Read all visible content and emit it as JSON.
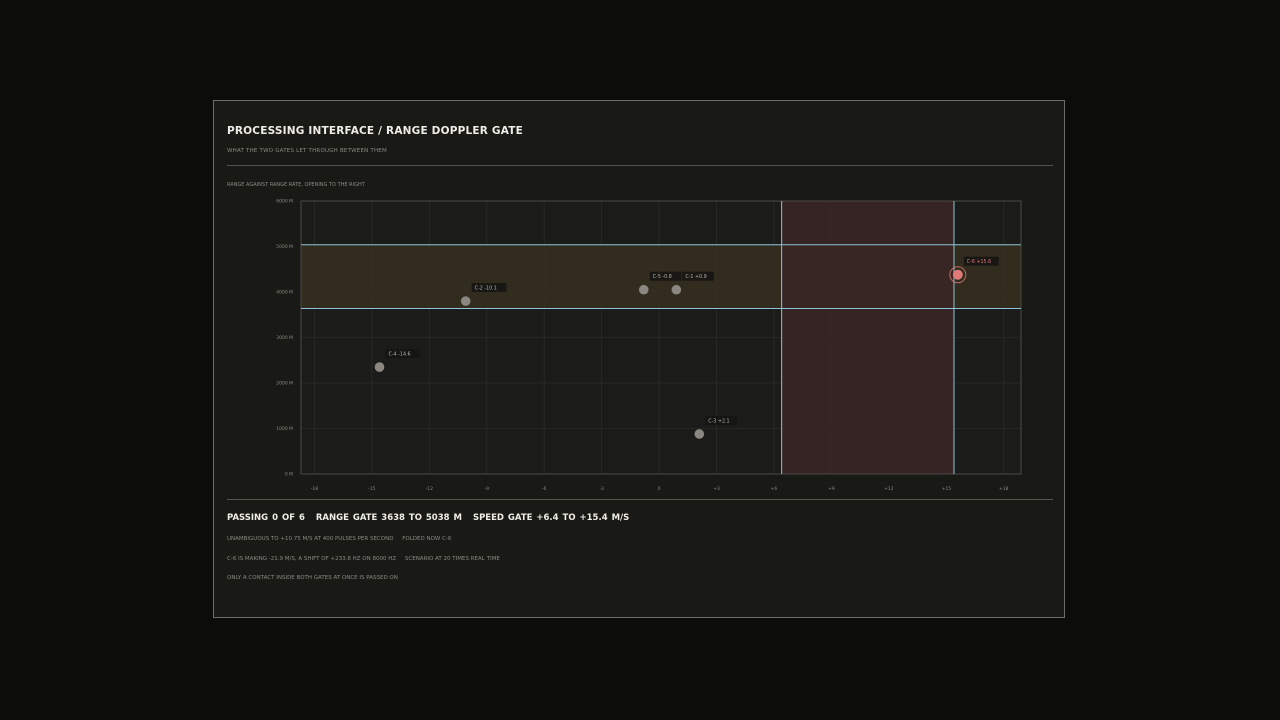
{
  "title": "PROCESSING INTERFACE / RANGE DOPPLER GATE",
  "subtitle": "WHAT THE TWO GATES LET THROUGH BETWEEN THEM",
  "chart_caption": "RANGE AGAINST RANGE RATE, OPENING TO THE RIGHT",
  "status": {
    "passing": "PASSING 0 OF 6",
    "range_gate": "RANGE GATE 3638 TO 5038 M",
    "speed_gate": "SPEED GATE  +6.4 TO +15.4 M/S"
  },
  "notes": {
    "line1_a": "UNAMBIGUOUS TO +10.75 M/S AT 400 PULSES PER SECOND",
    "line1_b": "FOLDED NOW C-6",
    "line2_a": "C-6 IS MAKING -21.9 M/S, A SHIFT OF +233.8 HZ ON 8000 HZ",
    "line2_b": "SCENARIO AT 20 TIMES REAL TIME",
    "line3": "ONLY A CONTACT INSIDE BOTH GATES AT ONCE IS PASSED ON"
  },
  "colors": {
    "gate_line": "#8fc3d8",
    "range_gate_fill": "#3a3120",
    "speed_gate_fill": "#3a2626",
    "contact": "#8a8780",
    "folded_contact": "#e07a78",
    "grid": "#2b2b27"
  },
  "chart_data": {
    "type": "scatter",
    "x_ticks": [
      "-18",
      "-15",
      "-12",
      "-9",
      "-6",
      "-3",
      "0",
      "+3",
      "+6",
      "+9",
      "+12",
      "+15",
      "+18"
    ],
    "y_ticks": [
      "0 M",
      "1000 M",
      "2000 M",
      "3000 M",
      "4000 M",
      "5000 M",
      "6000 M"
    ],
    "xlim": [
      -18.7,
      18.9
    ],
    "ylim": [
      0,
      6000
    ],
    "grid": true,
    "range_gate": [
      3638,
      5038
    ],
    "speed_gate": [
      6.4,
      15.4
    ],
    "points": [
      {
        "label": "C-1 +0.9",
        "x": 0.9,
        "y": 4050,
        "folded": false
      },
      {
        "label": "C-2 -10.1",
        "x": -10.1,
        "y": 3800,
        "folded": false
      },
      {
        "label": "C-3 +2.1",
        "x": 2.1,
        "y": 880,
        "folded": false
      },
      {
        "label": "C-4 -14.6",
        "x": -14.6,
        "y": 2350,
        "folded": false
      },
      {
        "label": "C-5 -0.8",
        "x": -0.8,
        "y": 4050,
        "folded": false
      },
      {
        "label": "C-6 +15.6",
        "x": 15.6,
        "y": 4380,
        "folded": true
      }
    ]
  }
}
